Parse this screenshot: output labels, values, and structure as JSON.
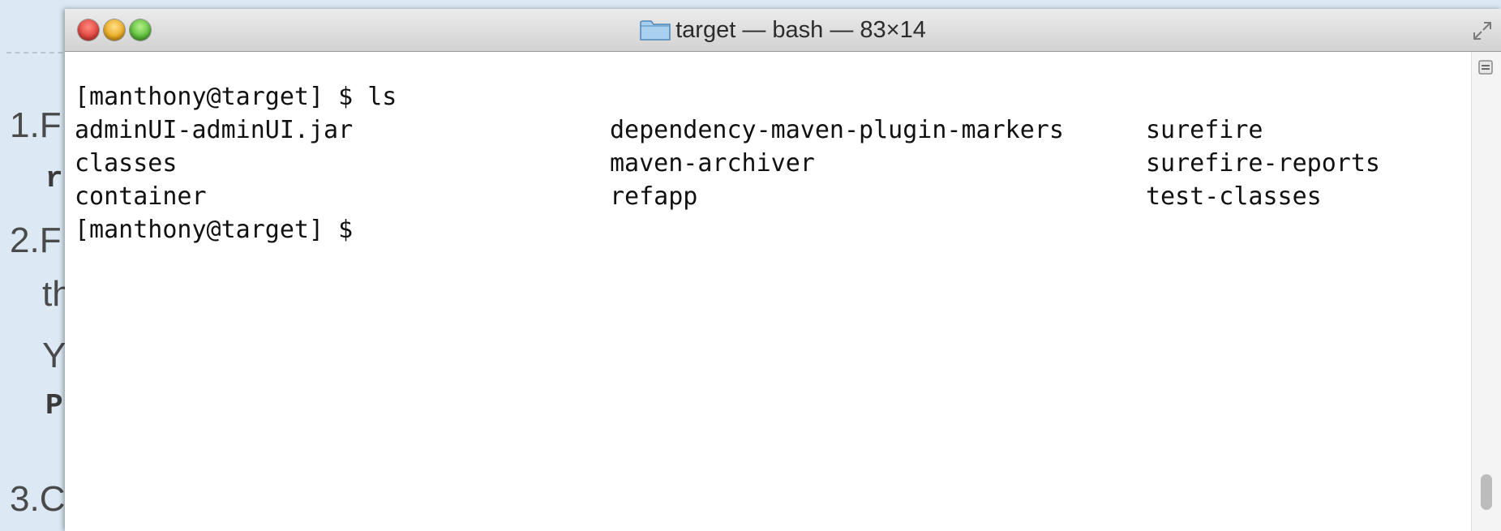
{
  "window": {
    "title": "target — bash — 83×14",
    "folder_icon": "folder-icon"
  },
  "terminal": {
    "prompt1": "[manthony@target] $ ls",
    "rows": [
      [
        "adminUI-adminUI.jar",
        "dependency-maven-plugin-markers",
        "surefire"
      ],
      [
        "classes",
        "maven-archiver",
        "surefire-reports"
      ],
      [
        "container",
        "refapp",
        "test-classes"
      ]
    ],
    "prompt2": "[manthony@target] $"
  },
  "slide": {
    "item1": "1.F",
    "item1_code": "r",
    "item2": "2.F",
    "item2_cont": "th",
    "item2_para": "Y",
    "item2_code": "P",
    "item3": "3.C"
  },
  "colors": {
    "slide_bg": "#dce9f4",
    "close": "#e0443e",
    "minimize": "#e8a920",
    "zoom": "#5bbd3b"
  }
}
